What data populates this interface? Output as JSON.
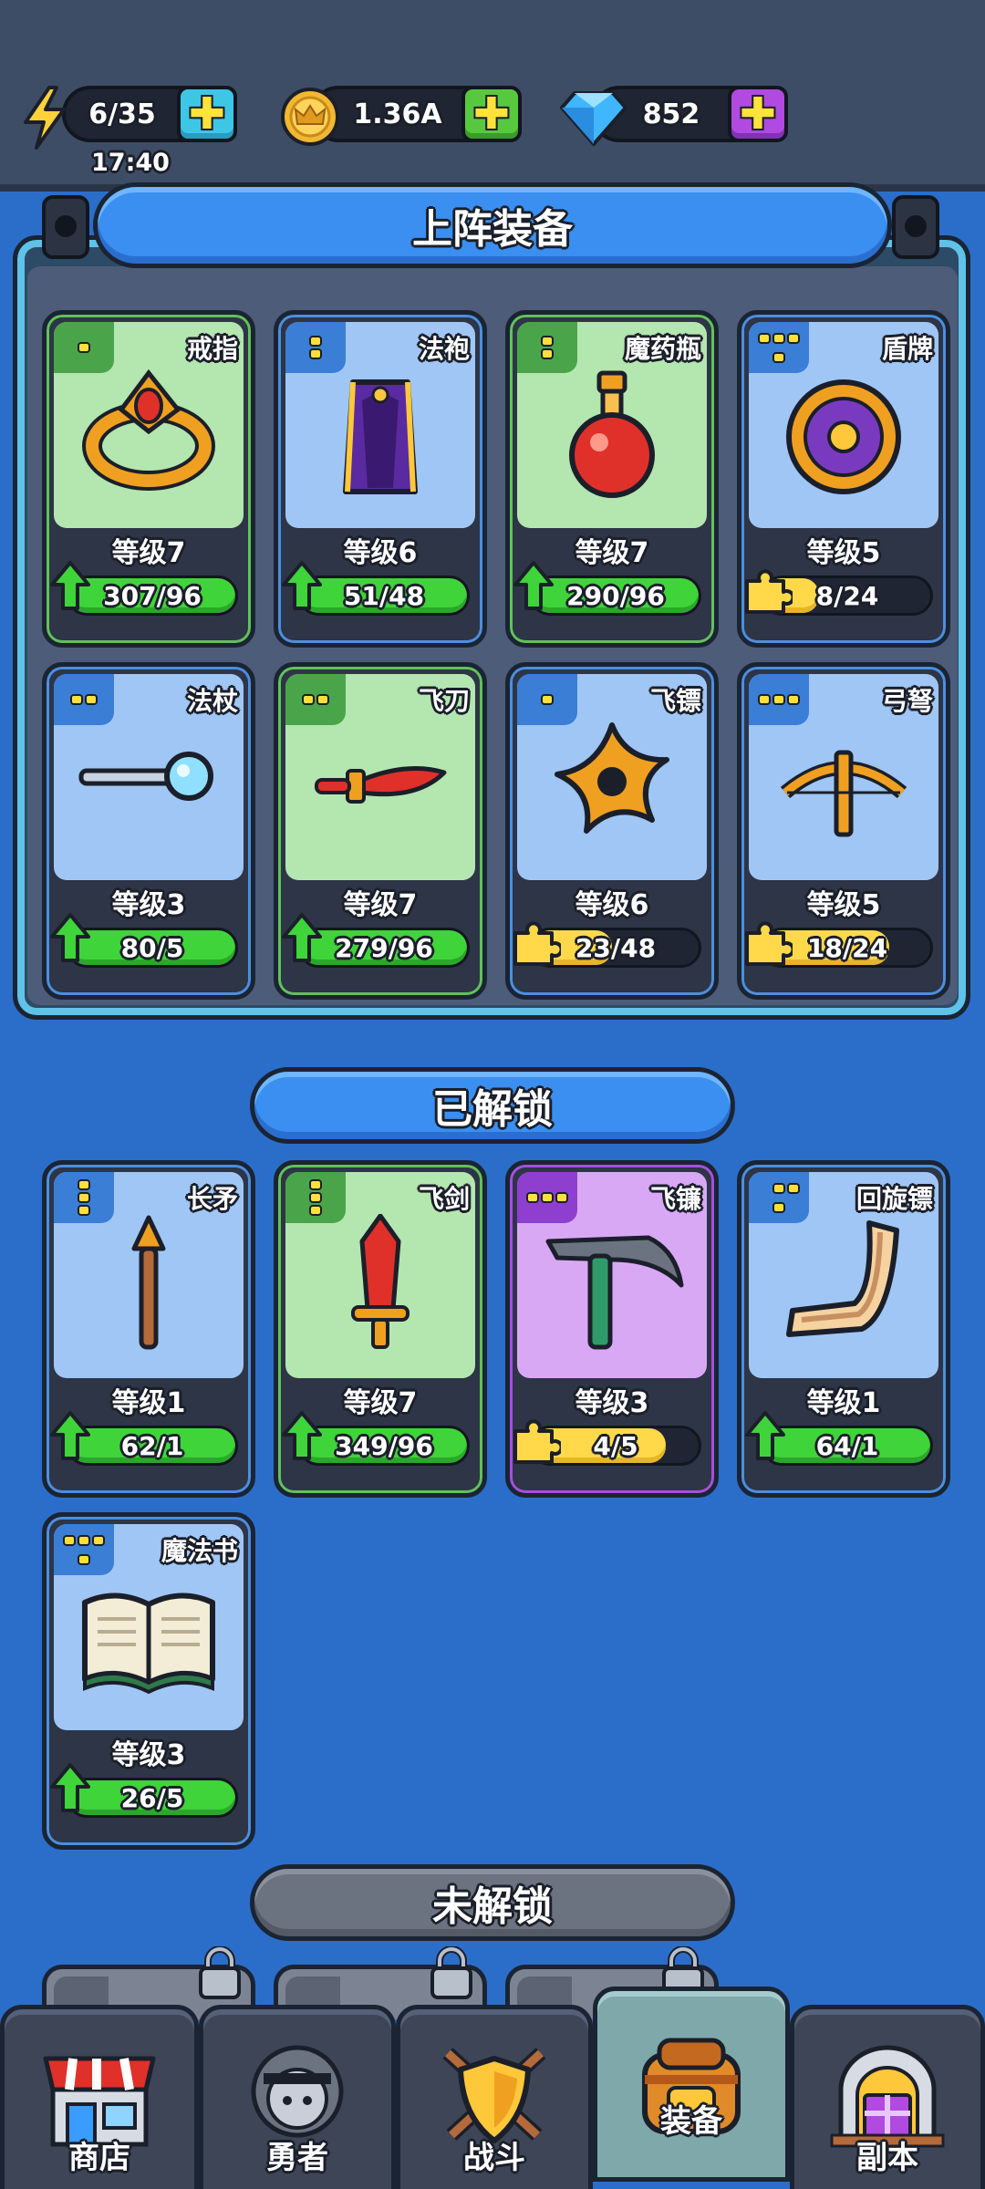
{
  "status": {
    "energy": "6/35",
    "energy_timer": "17:40",
    "gold": "1.36A",
    "gems": "852"
  },
  "equipped": {
    "title": "上阵装备",
    "items": [
      {
        "name": "戒指",
        "level": "等级7",
        "count": "307/96",
        "progress": 1.0,
        "upgradable": true,
        "rarity": "green"
      },
      {
        "name": "法袍",
        "level": "等级6",
        "count": "51/48",
        "progress": 1.0,
        "upgradable": true,
        "rarity": "blue"
      },
      {
        "name": "魔药瓶",
        "level": "等级7",
        "count": "290/96",
        "progress": 1.0,
        "upgradable": true,
        "rarity": "green"
      },
      {
        "name": "盾牌",
        "level": "等级5",
        "count": "8/24",
        "progress": 0.33,
        "upgradable": false,
        "rarity": "blue"
      },
      {
        "name": "法杖",
        "level": "等级3",
        "count": "80/5",
        "progress": 1.0,
        "upgradable": true,
        "rarity": "blue"
      },
      {
        "name": "飞刀",
        "level": "等级7",
        "count": "279/96",
        "progress": 1.0,
        "upgradable": true,
        "rarity": "green"
      },
      {
        "name": "飞镖",
        "level": "等级6",
        "count": "23/48",
        "progress": 0.48,
        "upgradable": false,
        "rarity": "blue"
      },
      {
        "name": "弓弩",
        "level": "等级5",
        "count": "18/24",
        "progress": 0.75,
        "upgradable": false,
        "rarity": "blue"
      }
    ]
  },
  "unlocked": {
    "title": "已解锁",
    "items": [
      {
        "name": "长矛",
        "level": "等级1",
        "count": "62/1",
        "progress": 1.0,
        "upgradable": true,
        "rarity": "blue"
      },
      {
        "name": "飞剑",
        "level": "等级7",
        "count": "349/96",
        "progress": 1.0,
        "upgradable": true,
        "rarity": "green"
      },
      {
        "name": "飞镰",
        "level": "等级3",
        "count": "4/5",
        "progress": 0.8,
        "upgradable": false,
        "rarity": "purple"
      },
      {
        "name": "回旋镖",
        "level": "等级1",
        "count": "64/1",
        "progress": 1.0,
        "upgradable": true,
        "rarity": "blue"
      },
      {
        "name": "魔法书",
        "level": "等级3",
        "count": "26/5",
        "progress": 1.0,
        "upgradable": true,
        "rarity": "blue"
      }
    ]
  },
  "locked": {
    "title": "未解锁"
  },
  "nav": {
    "tabs": [
      {
        "label": "商店",
        "icon": "shop-icon"
      },
      {
        "label": "勇者",
        "icon": "hero-icon"
      },
      {
        "label": "战斗",
        "icon": "battle-icon"
      },
      {
        "label": "装备",
        "icon": "equipment-icon",
        "active": true
      },
      {
        "label": "副本",
        "icon": "dungeon-icon"
      }
    ]
  },
  "colors": {
    "green_card": "#b4e6b0",
    "blue_card": "#9fc6f5",
    "purple_card": "#d8a8f5",
    "progress_green": "#3fd43a",
    "progress_yellow": "#ffd94a"
  }
}
